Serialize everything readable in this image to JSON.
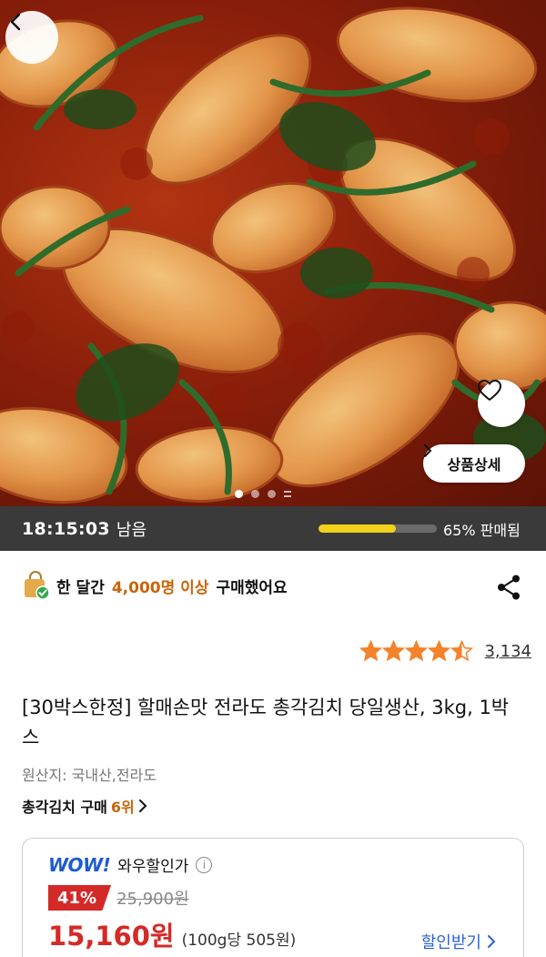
{
  "hero": {
    "image_alt": "chonggak kimchi photo",
    "detail_label": "상품상세",
    "carousel_dots": 3,
    "carousel_active": 0
  },
  "timer": {
    "time": "18:15:03",
    "suffix": "남음",
    "sold_percent": 65,
    "sold_text": "65% 판매됨"
  },
  "buyers": {
    "prefix": "한 달간",
    "count": "4,000명 이상",
    "suffix": "구매했어요"
  },
  "rating": {
    "stars": 4.5,
    "review_count": "3,134"
  },
  "product": {
    "title": "[30박스한정] 할매손맛 전라도 총각김치 당일생산, 3kg, 1박스",
    "origin": "원산지: 국내산,전라도",
    "rank_label": "총각김치 구매",
    "rank_value": "6위"
  },
  "price": {
    "wow_logo": "WOW!",
    "wow_label": "와우할인가",
    "discount": "41%",
    "original": "25,900원",
    "sale": "15,160원",
    "unit": "(100g당 505원)",
    "coupon_label": "할인받기"
  },
  "colors": {
    "accent_orange": "#c8650a",
    "sale_red": "#d42a27",
    "wow_blue": "#1e5bcf",
    "progress_yellow": "#f2d21b",
    "star_orange": "#f5822a"
  },
  "icons": {
    "back": "chevron-left-icon",
    "wishlist": "heart-icon",
    "share": "share-icon",
    "buyers": "shopping-bag-check-icon",
    "info": "info-icon"
  }
}
